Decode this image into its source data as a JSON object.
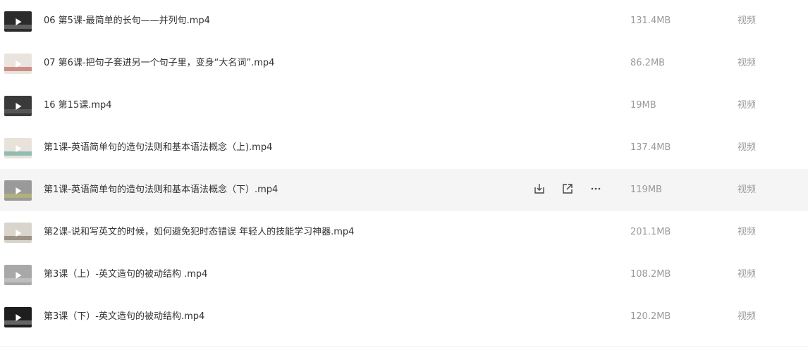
{
  "files": [
    {
      "name": "06 第5课-最简单的长句——并列句.mp4",
      "size": "131.4MB",
      "type": "视频",
      "thumb_color": "#2b2b2b",
      "thumb_accent": "#8a8a8a"
    },
    {
      "name": "07 第6课-把句子套进另一个句子里，变身“大名词”.mp4",
      "size": "86.2MB",
      "type": "视频",
      "thumb_color": "#e9e4de",
      "thumb_accent": "#b5473e"
    },
    {
      "name": "16 第15课.mp4",
      "size": "19MB",
      "type": "视频",
      "thumb_color": "#3a3a3a",
      "thumb_accent": "#6e6e6e"
    },
    {
      "name": "第1课-英语简单句的造句法则和基本语法概念（上).mp4",
      "size": "137.4MB",
      "type": "视频",
      "thumb_color": "#e8e2da",
      "thumb_accent": "#4a9a96"
    },
    {
      "name": "第1课-英语简单句的造句法则和基本语法概念（下）.mp4",
      "size": "119MB",
      "type": "视频",
      "thumb_color": "#9a9a9a",
      "thumb_accent": "#c9c36a"
    },
    {
      "name": "第2课-说和写英文的时候，如何避免犯时态错误  年轻人的技能学习神器.mp4",
      "size": "201.1MB",
      "type": "视频",
      "thumb_color": "#d9d4cc",
      "thumb_accent": "#6b5b4f"
    },
    {
      "name": "第3课（上）-英文造句的被动结构 .mp4",
      "size": "108.2MB",
      "type": "视频",
      "thumb_color": "#a8a8a8",
      "thumb_accent": "#cfcfcf"
    },
    {
      "name": "第3课（下）-英文造句的被动结构.mp4",
      "size": "120.2MB",
      "type": "视频",
      "thumb_color": "#1e1e1e",
      "thumb_accent": "#a0a0a0"
    }
  ],
  "hover_row": 4,
  "actions": [
    {
      "icon": "download-icon"
    },
    {
      "icon": "share-icon"
    },
    {
      "icon": "more-icon"
    }
  ]
}
